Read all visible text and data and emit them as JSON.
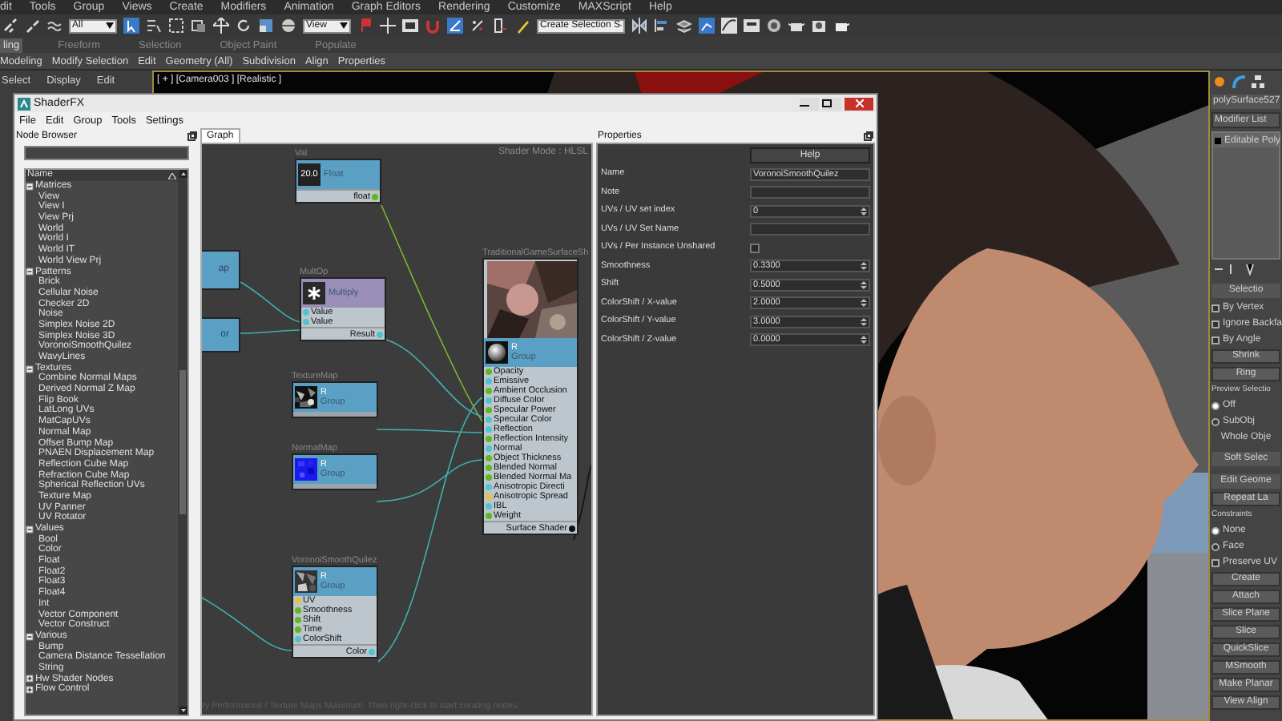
{
  "menu_bar": [
    "dit",
    "Tools",
    "Group",
    "Views",
    "Create",
    "Modifiers",
    "Animation",
    "Graph Editors",
    "Rendering",
    "Customize",
    "MAXScript",
    "Help"
  ],
  "toolbar": {
    "selection_filter": "All",
    "reference_coordinate": "View",
    "named_selection": "Create Selection S"
  },
  "ribbon_tabs": [
    {
      "label": "ling",
      "selected": true
    },
    {
      "label": "Freeform",
      "selected": false
    },
    {
      "label": "Selection",
      "selected": false
    },
    {
      "label": "Object Paint",
      "selected": false
    },
    {
      "label": "Populate",
      "selected": false
    }
  ],
  "ribbon_panels": [
    "Modeling",
    "Modify Selection",
    "Edit",
    "Geometry (All)",
    "Subdivision",
    "Align",
    "Properties"
  ],
  "explorer_menu": [
    "Select",
    "Display",
    "Edit"
  ],
  "viewport": {
    "label": "[ + ] [Camera003 ] [Realistic ]"
  },
  "shaderfx": {
    "title": "ShaderFX",
    "menu": [
      "File",
      "Edit",
      "Group",
      "Tools",
      "Settings"
    ],
    "node_browser": {
      "title": "Node Browser",
      "column": "Name",
      "tree": [
        {
          "label": "Matrices",
          "expanded": true,
          "children": [
            "View",
            "View I",
            "View Prj",
            "World",
            "World I",
            "World IT",
            "World View Prj"
          ]
        },
        {
          "label": "Patterns",
          "expanded": true,
          "children": [
            "Brick",
            "Cellular Noise",
            "Checker 2D",
            "Noise",
            "Simplex Noise 2D",
            "Simplex Noise 3D",
            "VoronoiSmoothQuilez",
            "WavyLines"
          ]
        },
        {
          "label": "Textures",
          "expanded": true,
          "children": [
            "Combine Normal Maps",
            "Derived Normal Z Map",
            "Flip Book",
            "LatLong UVs",
            "MatCapUVs",
            "Normal Map",
            "Offset Bump Map",
            "PNAEN Displacement Map",
            "Reflection Cube Map",
            "Refraction Cube Map",
            "Spherical Reflection UVs",
            "Texture Map",
            "UV Panner",
            "UV Rotator"
          ]
        },
        {
          "label": "Values",
          "expanded": true,
          "children": [
            "Bool",
            "Color",
            "Float",
            "Float2",
            "Float3",
            "Float4",
            "Int",
            "Vector Component",
            "Vector Construct"
          ]
        },
        {
          "label": "Various",
          "expanded": true,
          "children": [
            "Bump",
            "Camera Distance Tessellation",
            "String"
          ]
        },
        {
          "label": "Hw Shader Nodes",
          "expanded": false
        },
        {
          "label": "Flow Control",
          "expanded": false
        }
      ]
    },
    "graph": {
      "tab": "Graph",
      "mode_text": "Shader Mode : HLSL",
      "hint_text": "ry Performance / Texture Maps Maximum. Then right-click to start creating nodes.",
      "nodes": [
        {
          "kind": "partial",
          "title": "ap"
        },
        {
          "kind": "partial",
          "title": "or"
        },
        {
          "kind": "float",
          "label": "Val",
          "swatch": "20.0",
          "title": "Float",
          "output": {
            "label": "float",
            "color": "#5fb820"
          }
        },
        {
          "kind": "multiply",
          "label": "MultOp",
          "title": "Multiply",
          "inputs": [
            {
              "label": "Value",
              "color": "#4fc4d0"
            },
            {
              "label": "Value",
              "color": "#4fc4d0"
            }
          ],
          "output": {
            "label": "Result",
            "color": "#4fc4d0"
          }
        },
        {
          "kind": "texture",
          "label": "TextureMap",
          "channel": "R",
          "title": "Group"
        },
        {
          "kind": "normal",
          "label": "NormalMap",
          "channel": "R",
          "title": "Group"
        },
        {
          "kind": "noise",
          "label": "VoronoiSmoothQuilez",
          "channel": "R",
          "title": "Group",
          "inputs": [
            {
              "label": "UV",
              "color": "#e8c23a"
            },
            {
              "label": "Smoothness",
              "color": "#5fb820"
            },
            {
              "label": "Shift",
              "color": "#5fb820"
            },
            {
              "label": "Time",
              "color": "#5fb820"
            },
            {
              "label": "ColorShift",
              "color": "#4fc4d0"
            }
          ],
          "output": {
            "label": "Color",
            "color": "#4fc4d0"
          }
        },
        {
          "kind": "surface",
          "label": "TraditionalGameSurfaceSh",
          "channel": "R",
          "title": "Group",
          "inputs": [
            {
              "label": "Opacity",
              "color": "#5fb820"
            },
            {
              "label": "Emissive",
              "color": "#4fc4d0"
            },
            {
              "label": "Ambient Occlusion",
              "color": "#5fb820"
            },
            {
              "label": "Diffuse Color",
              "color": "#4fc4d0"
            },
            {
              "label": "Specular Power",
              "color": "#5fb820"
            },
            {
              "label": "Specular Color",
              "color": "#4fc4d0"
            },
            {
              "label": "Reflection",
              "color": "#4fc4d0"
            },
            {
              "label": "Reflection Intensity",
              "color": "#5fb820"
            },
            {
              "label": "Normal",
              "color": "#4fc4d0"
            },
            {
              "label": "Object Thickness",
              "color": "#5fb820"
            },
            {
              "label": "Blended Normal",
              "color": "#5fb820"
            },
            {
              "label": "Blended Normal Ma",
              "color": "#5fb820"
            },
            {
              "label": "Anisotropic Directi",
              "color": "#4fc4d0"
            },
            {
              "label": "Anisotropic Spread",
              "color": "#e8c23a"
            },
            {
              "label": "IBL",
              "color": "#4fc4d0"
            },
            {
              "label": "Weight",
              "color": "#5fb820"
            }
          ],
          "output": {
            "label": "Surface Shader",
            "color": "#111111"
          }
        }
      ]
    },
    "properties": {
      "title": "Properties",
      "help": "Help",
      "rows": [
        {
          "kind": "text",
          "label": "Name",
          "value": "VoronoiSmoothQuilez"
        },
        {
          "kind": "text",
          "label": "Note"
        },
        {
          "kind": "spin",
          "label": "UVs / UV set index",
          "value": "0"
        },
        {
          "kind": "text",
          "label": "UVs / UV Set Name"
        },
        {
          "kind": "check",
          "label": "UVs / Per Instance Unshared",
          "checked": false
        },
        {
          "kind": "spin",
          "label": "Smoothness",
          "value": "0.3300"
        },
        {
          "kind": "spin",
          "label": "Shift",
          "value": "0.5000"
        },
        {
          "kind": "spin",
          "label": "ColorShift / X-value",
          "value": "2.0000"
        },
        {
          "kind": "spin",
          "label": "ColorShift / Y-value",
          "value": "3.0000"
        },
        {
          "kind": "spin",
          "label": "ColorShift / Z-value",
          "value": "0.0000"
        }
      ]
    }
  },
  "command_panel": {
    "object_name": "polySurface527",
    "modifier_list": "Modifier List",
    "stack": [
      "Editable Poly"
    ],
    "items": [
      {
        "kind": "rollout",
        "label": "Selectio"
      },
      {
        "kind": "check",
        "label": "By Vertex",
        "checked": false
      },
      {
        "kind": "check",
        "label": "Ignore Backfa",
        "checked": false
      },
      {
        "kind": "check",
        "label": "By Angle",
        "checked": false
      },
      {
        "kind": "button",
        "label": "Shrink"
      },
      {
        "kind": "button",
        "label": "Ring"
      },
      {
        "kind": "heading",
        "label": "Preview Selectio"
      },
      {
        "kind": "radio",
        "label": "Off",
        "selected": true
      },
      {
        "kind": "radio",
        "label": "SubObj",
        "selected": false
      },
      {
        "kind": "text",
        "label": "Whole Obje"
      },
      {
        "kind": "rollout",
        "label": "Soft Selec"
      },
      {
        "kind": "rollout",
        "label": "Edit Geome"
      },
      {
        "kind": "button",
        "label": "Repeat La"
      },
      {
        "kind": "heading",
        "label": "Constraints"
      },
      {
        "kind": "radio",
        "label": "None",
        "selected": true
      },
      {
        "kind": "radio",
        "label": "Face",
        "selected": false
      },
      {
        "kind": "check",
        "label": "Preserve UV",
        "checked": false
      },
      {
        "kind": "button",
        "label": "Create"
      },
      {
        "kind": "button",
        "label": "Attach"
      },
      {
        "kind": "button",
        "label": "Slice Plane"
      },
      {
        "kind": "button",
        "label": "Slice"
      },
      {
        "kind": "button",
        "label": "QuickSlice"
      },
      {
        "kind": "button",
        "label": "MSmooth"
      },
      {
        "kind": "button",
        "label": "Make Planar"
      },
      {
        "kind": "button",
        "label": "View Align"
      }
    ]
  }
}
